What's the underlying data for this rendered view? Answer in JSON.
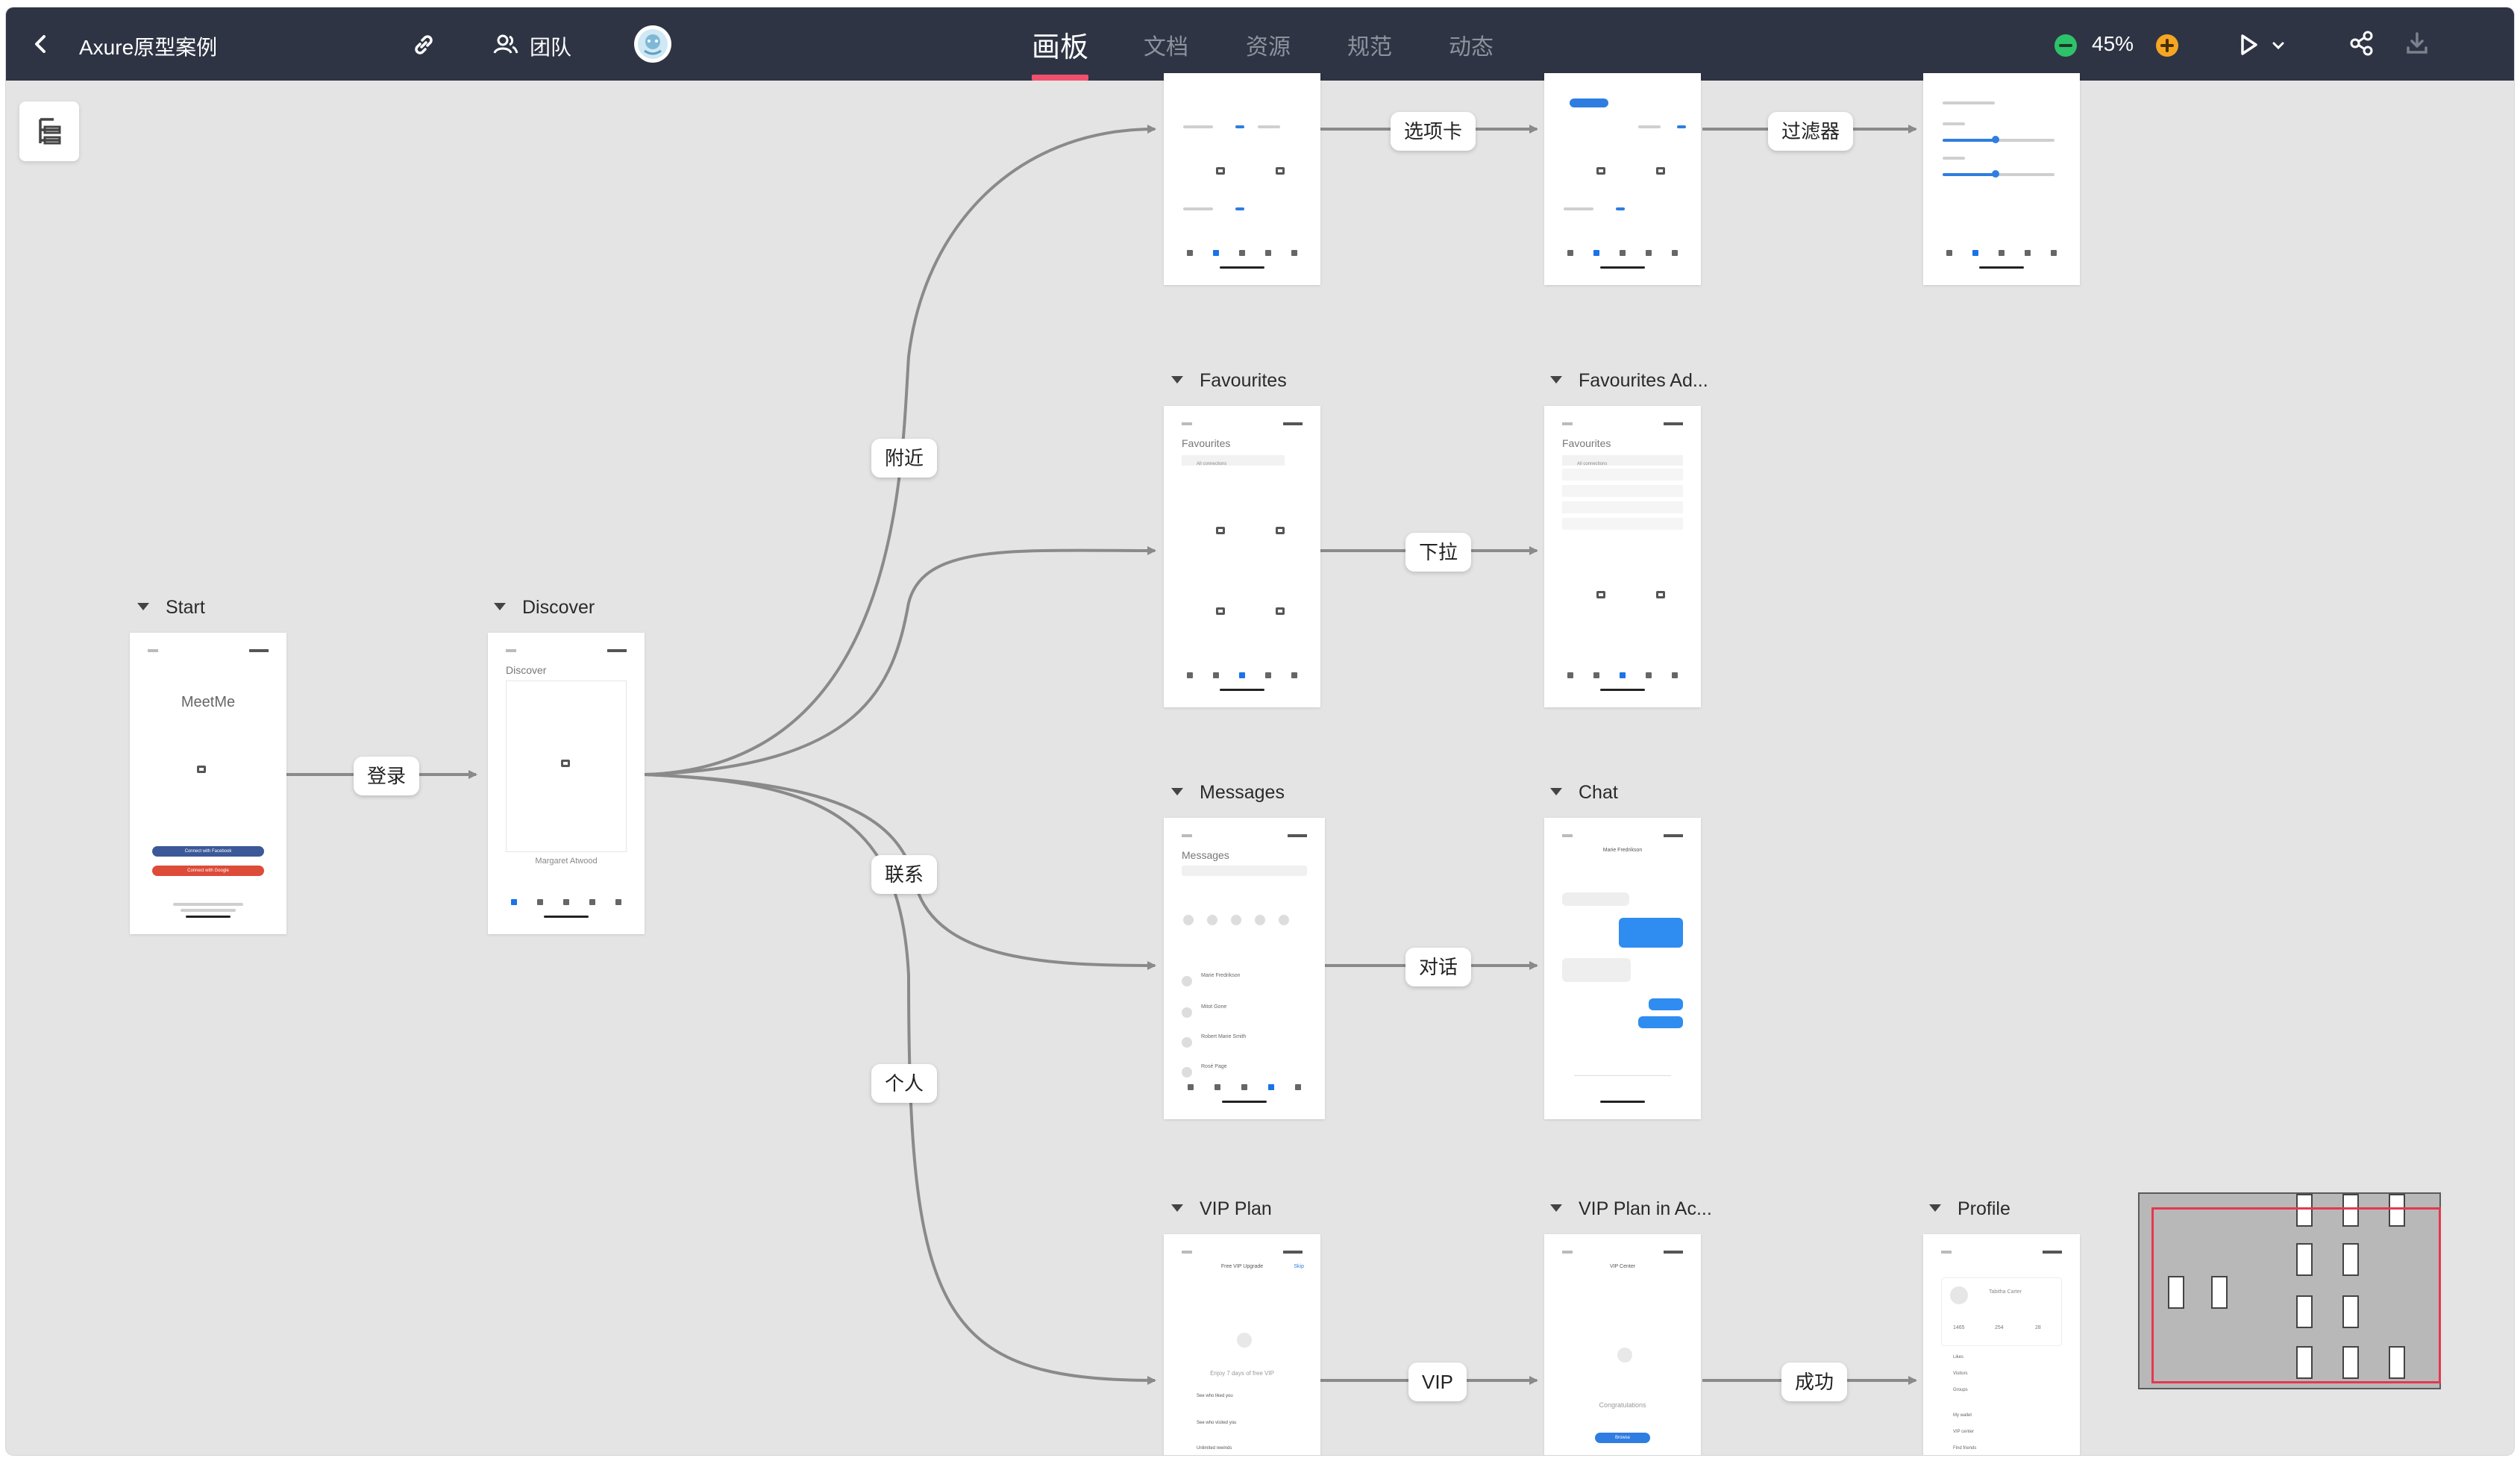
{
  "app": {
    "title": "Axure原型案例",
    "team_label": "团队",
    "zoom": "45%",
    "colors": {
      "topbar": "#2e3444",
      "accent": "#f0506e",
      "canvas": "#e4e4e4",
      "zoom_minus": "#2ec26a",
      "zoom_plus": "#f5a623"
    }
  },
  "tabs": [
    {
      "label": "画板",
      "active": true
    },
    {
      "label": "文档",
      "active": false
    },
    {
      "label": "资源",
      "active": false
    },
    {
      "label": "规范",
      "active": false
    },
    {
      "label": "动态",
      "active": false
    }
  ],
  "icons": {
    "back": "chevron-left-icon",
    "link": "link-icon",
    "team": "team-icon",
    "avatar": "avatar-icon",
    "zoom_out": "minus-circle-icon",
    "zoom_in": "plus-circle-icon",
    "play": "play-icon",
    "play_menu": "chevron-down-icon",
    "share": "share-icon",
    "download": "download-icon",
    "outline": "outline-icon"
  },
  "frames": {
    "start": {
      "title": "Start",
      "app_name": "MeetMe",
      "btn1": "Connect with Facebook",
      "btn2": "Connect with Google"
    },
    "discover": {
      "title": "Discover",
      "screen_title": "Discover",
      "person": "Margaret Atwood"
    },
    "nearby1": {
      "title": ""
    },
    "nearby2": {
      "title": ""
    },
    "nearby3": {
      "title": ""
    },
    "favourites": {
      "title": "Favourites",
      "screen_title": "Favourites",
      "filter": "All connections"
    },
    "favourites_ad": {
      "title": "Favourites Ad...",
      "screen_title": "Favourites",
      "filter": "All connections"
    },
    "messages": {
      "title": "Messages",
      "screen_title": "Messages",
      "names": [
        "Marie Fredrikson",
        "Mitot Gone",
        "Robert Marie Smith",
        "Rosé Page"
      ]
    },
    "chat": {
      "title": "Chat",
      "contact": "Marie Fredrikson"
    },
    "vip_plan": {
      "title": "VIP Plan",
      "header": "Free VIP Upgrade",
      "skip": "Skip",
      "promo": "Enjoy 7 days of free VIP",
      "features": [
        "See who liked you",
        "See who visited you",
        "Unlimited rewinds"
      ]
    },
    "vip_active": {
      "title": "VIP Plan in Ac...",
      "header": "VIP Center",
      "congrats": "Congratulations",
      "button": "Browse"
    },
    "profile": {
      "title": "Profile",
      "name": "Tabitha Carter",
      "stats": [
        "1465",
        "254",
        "28"
      ],
      "menu": [
        "Likes",
        "Visitors",
        "Groups",
        "My wallet",
        "VIP center",
        "Find friends"
      ]
    }
  },
  "links": [
    {
      "id": "login",
      "label": "登录"
    },
    {
      "id": "nearby",
      "label": "附近"
    },
    {
      "id": "tabs",
      "label": "选项卡"
    },
    {
      "id": "filter",
      "label": "过滤器"
    },
    {
      "id": "pull",
      "label": "下拉"
    },
    {
      "id": "contact",
      "label": "联系"
    },
    {
      "id": "dialog",
      "label": "对话"
    },
    {
      "id": "personal",
      "label": "个人"
    },
    {
      "id": "vip",
      "label": "VIP"
    },
    {
      "id": "success",
      "label": "成功"
    }
  ]
}
